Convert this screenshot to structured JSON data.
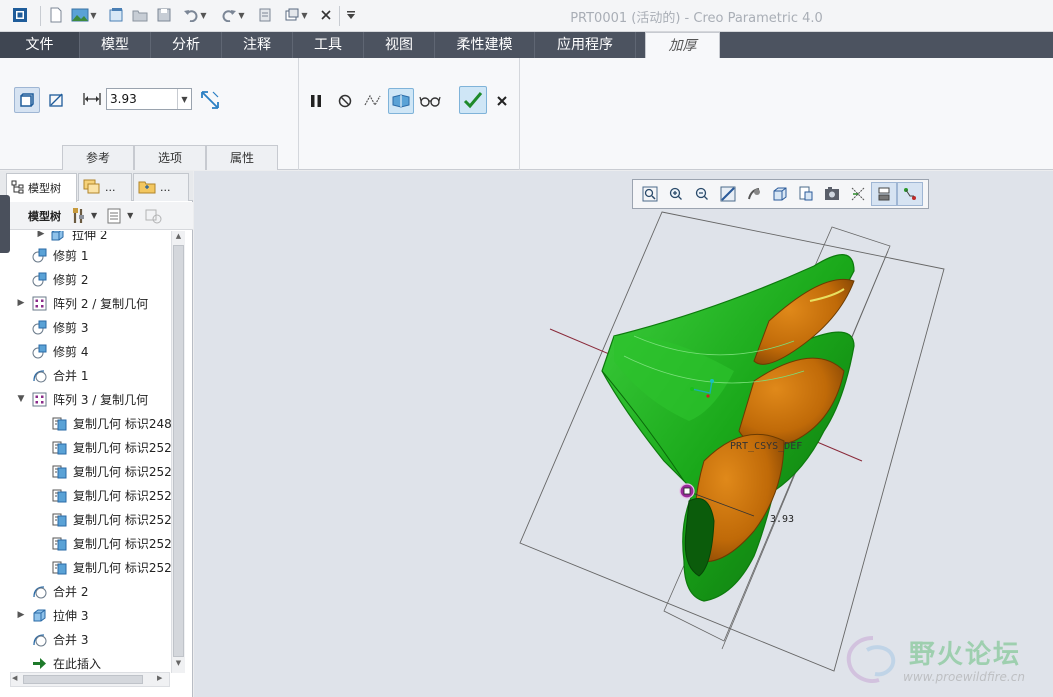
{
  "window": {
    "title": "PRT0001 (活动的) - Creo Parametric 4.0"
  },
  "ribbon_tabs": [
    {
      "label": "文件"
    },
    {
      "label": "模型"
    },
    {
      "label": "分析"
    },
    {
      "label": "注释"
    },
    {
      "label": "工具"
    },
    {
      "label": "视图"
    },
    {
      "label": "柔性建模"
    },
    {
      "label": "应用程序"
    },
    {
      "label": "加厚"
    }
  ],
  "thicken": {
    "thickness_value": "3.93",
    "sub_tabs": {
      "reference": "参考",
      "options": "选项",
      "properties": "属性"
    }
  },
  "panel": {
    "tabs": {
      "model_tree": "模型树",
      "layers": "...",
      "folder": "..."
    },
    "toolbar_label": "模型树"
  },
  "tree": {
    "partial_top": "拉伸 2",
    "items": [
      {
        "label": "修剪 1",
        "icon": "trim-icon",
        "expand": ""
      },
      {
        "label": "修剪 2",
        "icon": "trim-icon",
        "expand": ""
      },
      {
        "label": "阵列 2 / 复制几何",
        "icon": "pattern-icon",
        "expand": "▶"
      },
      {
        "label": "修剪 3",
        "icon": "trim-icon",
        "expand": ""
      },
      {
        "label": "修剪 4",
        "icon": "trim-icon",
        "expand": ""
      },
      {
        "label": "合并 1",
        "icon": "merge-icon",
        "expand": ""
      },
      {
        "label": "阵列 3 / 复制几何",
        "icon": "pattern-icon",
        "expand": "▼"
      },
      {
        "label": "复制几何 标识248",
        "icon": "copy-geometry-icon",
        "expand": "",
        "child": true
      },
      {
        "label": "复制几何 标识252",
        "icon": "copy-geometry-icon",
        "expand": "",
        "child": true
      },
      {
        "label": "复制几何 标识252",
        "icon": "copy-geometry-icon",
        "expand": "",
        "child": true
      },
      {
        "label": "复制几何 标识252",
        "icon": "copy-geometry-icon",
        "expand": "",
        "child": true
      },
      {
        "label": "复制几何 标识252",
        "icon": "copy-geometry-icon",
        "expand": "",
        "child": true
      },
      {
        "label": "复制几何 标识252",
        "icon": "copy-geometry-icon",
        "expand": "",
        "child": true
      },
      {
        "label": "复制几何 标识252",
        "icon": "copy-geometry-icon",
        "expand": "",
        "child": true
      },
      {
        "label": "合并 2",
        "icon": "merge-icon",
        "expand": ""
      },
      {
        "label": "拉伸 3",
        "icon": "extrude-icon",
        "expand": "▶"
      },
      {
        "label": "合并 3",
        "icon": "merge-icon",
        "expand": ""
      },
      {
        "label": "在此插入",
        "icon": "insert-here-arrow-icon",
        "expand": ""
      }
    ]
  },
  "viewport": {
    "csys_label": "PRT_CSYS_DEF",
    "dimension_label": "3.93"
  },
  "watermark": {
    "title": "野火论坛",
    "url": "www.proewildfire.cn"
  },
  "colors": {
    "model_green": "#1fb51f",
    "model_orange": "#c86e08",
    "tab_bar": "#4c5360",
    "viewport_bg": "#dfe3ea"
  }
}
